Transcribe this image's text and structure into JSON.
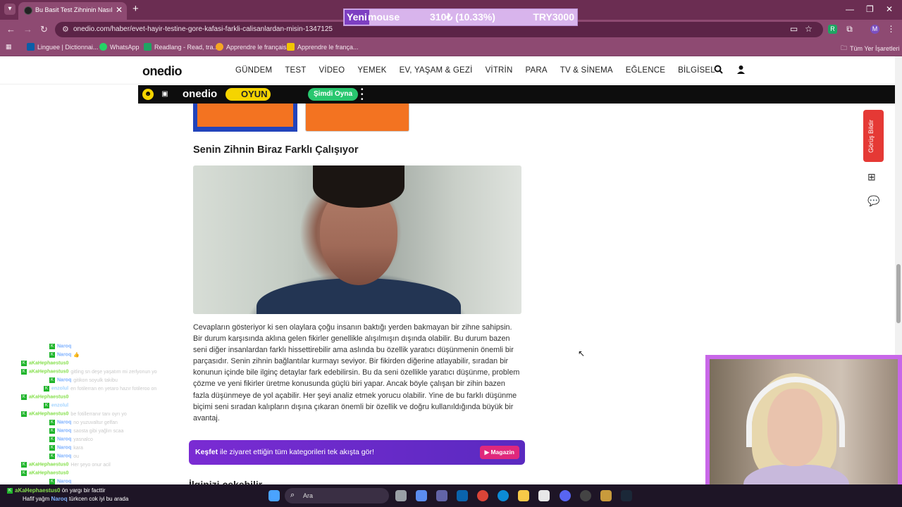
{
  "browser": {
    "tab_title": "Bu Basit Test Zihninin Nasıl Çalı",
    "url": "onedio.com/haber/evet-hayir-testine-gore-kafasi-farkli-calisanlardan-misin-1347125",
    "bookmarks": [
      "Linguee | Dictionnai...",
      "WhatsApp",
      "Readlang - Read, tra...",
      "Apprendre le français",
      "Apprendre le frança..."
    ],
    "all_bookmarks": "Tüm Yer İşaretleri"
  },
  "ticker": {
    "badge": "Yeni",
    "name": "mouse",
    "value": "310₺ (10.33%)",
    "goal": "TRY3000"
  },
  "site": {
    "logo": "onedio",
    "nav": [
      "GÜNDEM",
      "TEST",
      "VİDEO",
      "YEMEK",
      "EV, YAŞAM & GEZİ",
      "VİTRİN",
      "PARA",
      "TV & SİNEMA",
      "EĞLENCE",
      "BİLGİSEL"
    ]
  },
  "game_bar": {
    "logo": "onedio",
    "oyun": "OYUN",
    "play": "Şimdi Oyna"
  },
  "result": {
    "title": "Senin Zihnin Biraz Farklı Çalışıyor",
    "text": "Cevapların gösteriyor ki sen olaylara çoğu insanın baktığı yerden bakmayan bir zihne sahipsin. Bir durum karşısında aklına gelen fikirler genellikle alışılmışın dışında olabilir. Bu durum bazen seni diğer insanlardan farklı hissettirebilir ama aslında bu özellik yaratıcı düşünmenin önemli bir parçasıdır. Senin zihnin bağlantılar kurmayı seviyor. Bir fikirden diğerine atlayabilir, sıradan bir konunun içinde bile ilginç detaylar fark edebilirsin. Bu da seni özellikle yaratıcı düşünme, problem çözme ve yeni fikirler üretme konusunda güçlü biri yapar. Ancak böyle çalışan bir zihin bazen fazla düşünmeye de yol açabilir. Her şeyi analiz etmek yorucu olabilir. Yine de bu farklı düşünme biçimi seni sıradan kalıpların dışına çıkaran önemli bir özellik ve doğru kullanıldığında büyük bir avantaj."
  },
  "kesfet": {
    "bold": "Keşfet",
    "text": " ile ziyaret ettiğin tüm kategorileri tek akışta gör!",
    "button": "Magazin"
  },
  "next_heading": "İlginizi çekebilir",
  "feedback": "Görüş Bildir",
  "chat": [
    {
      "user": "Naroq",
      "color": "#7fb2ff",
      "msg": "",
      "indent": 40
    },
    {
      "user": "Naroq",
      "color": "#7fb2ff",
      "msg": "👍",
      "indent": 40
    },
    {
      "user": "aKaHephaestus0",
      "color": "#86e04d",
      "msg": "",
      "indent": 0
    },
    {
      "user": "aKaHephaestus0",
      "color": "#86e04d",
      "msg": "gitling sn deşe yaşatım mi zerlyonun yo",
      "indent": 0
    },
    {
      "user": "Naroq",
      "color": "#7fb2ff",
      "msg": "gitikon soyulk takibu",
      "indent": 40
    },
    {
      "user": "enzolul",
      "color": "#a4d4ff",
      "msg": "en fotilerran en yetaro hazır fotileroo on",
      "indent": 32
    },
    {
      "user": "aKaHephaestus0",
      "color": "#86e04d",
      "msg": "",
      "indent": 0
    },
    {
      "user": "enzolul",
      "color": "#a4d4ff",
      "msg": "",
      "indent": 32
    },
    {
      "user": "aKaHephaestus0",
      "color": "#86e04d",
      "msg": "be fotillerranır tanı oyrı yo",
      "indent": 0
    },
    {
      "user": "Naroq",
      "color": "#7fb2ff",
      "msg": "no yuzuvaltur gelfan",
      "indent": 40
    },
    {
      "user": "Naroq",
      "color": "#7fb2ff",
      "msg": "saosta gibi yağlırı scaa",
      "indent": 40
    },
    {
      "user": "Naroq",
      "color": "#7fb2ff",
      "msg": "yasnalco",
      "indent": 40
    },
    {
      "user": "Naroq",
      "color": "#7fb2ff",
      "msg": "kara",
      "indent": 40
    },
    {
      "user": "Naroq",
      "color": "#7fb2ff",
      "msg": "ou",
      "indent": 40
    },
    {
      "user": "aKaHephaestus0",
      "color": "#86e04d",
      "msg": "Her şeyo onur acil",
      "indent": 0
    },
    {
      "user": "aKaHephaestus0",
      "color": "#86e04d",
      "msg": "",
      "indent": 0
    },
    {
      "user": "Naroq",
      "color": "#7fb2ff",
      "msg": "",
      "indent": 40
    }
  ],
  "notification": {
    "line1_user": "aKaHephaestus0",
    "line1_msg": "ön yargı bir facttir",
    "line2_prefix": "Hafif yağm",
    "line2_user": "Naroq",
    "line2_msg": "türkcen cok iyi bu arada"
  },
  "taskbar": {
    "search_placeholder": "Ara"
  },
  "colors": {
    "tab_bar": "#6b2d52",
    "address_bar": "#8e4a72",
    "orange_option": "#f37321",
    "blue_option": "#2244bb",
    "kesfet_purple": "#7a2bd3",
    "feedback_red": "#e53935",
    "webcam_frame": "#c867e8"
  }
}
